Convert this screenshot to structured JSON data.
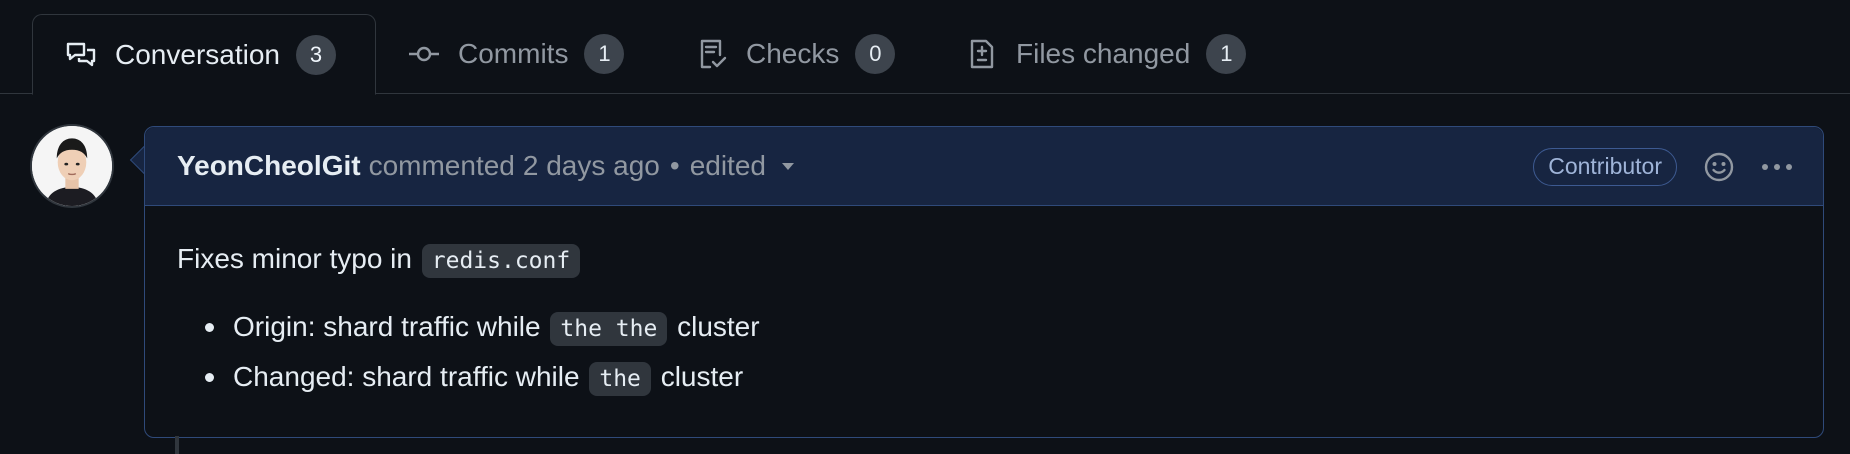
{
  "tabs": [
    {
      "label": "Conversation",
      "count": "3",
      "icon": "comment-discussion-icon",
      "active": true
    },
    {
      "label": "Commits",
      "count": "1",
      "icon": "git-commit-icon",
      "active": false
    },
    {
      "label": "Checks",
      "count": "0",
      "icon": "checklist-icon",
      "active": false
    },
    {
      "label": "Files changed",
      "count": "1",
      "icon": "file-diff-icon",
      "active": false
    }
  ],
  "comment": {
    "author": "YeonCheolGit",
    "action": "commented",
    "time": "2 days ago",
    "separator": "•",
    "edited": "edited",
    "role_badge": "Contributor",
    "body": {
      "intro": "Fixes minor typo in",
      "intro_code": "redis.conf",
      "items": [
        {
          "prefix": "Origin: shard traffic while",
          "code": "the the",
          "suffix": "cluster"
        },
        {
          "prefix": "Changed: shard traffic while",
          "code": "the",
          "suffix": "cluster"
        }
      ]
    }
  },
  "colors": {
    "background": "#0d1117",
    "header_background": "#172541",
    "border_accent": "#2f4a7a",
    "text_primary": "#e6edf3",
    "text_muted": "#9198a1"
  }
}
